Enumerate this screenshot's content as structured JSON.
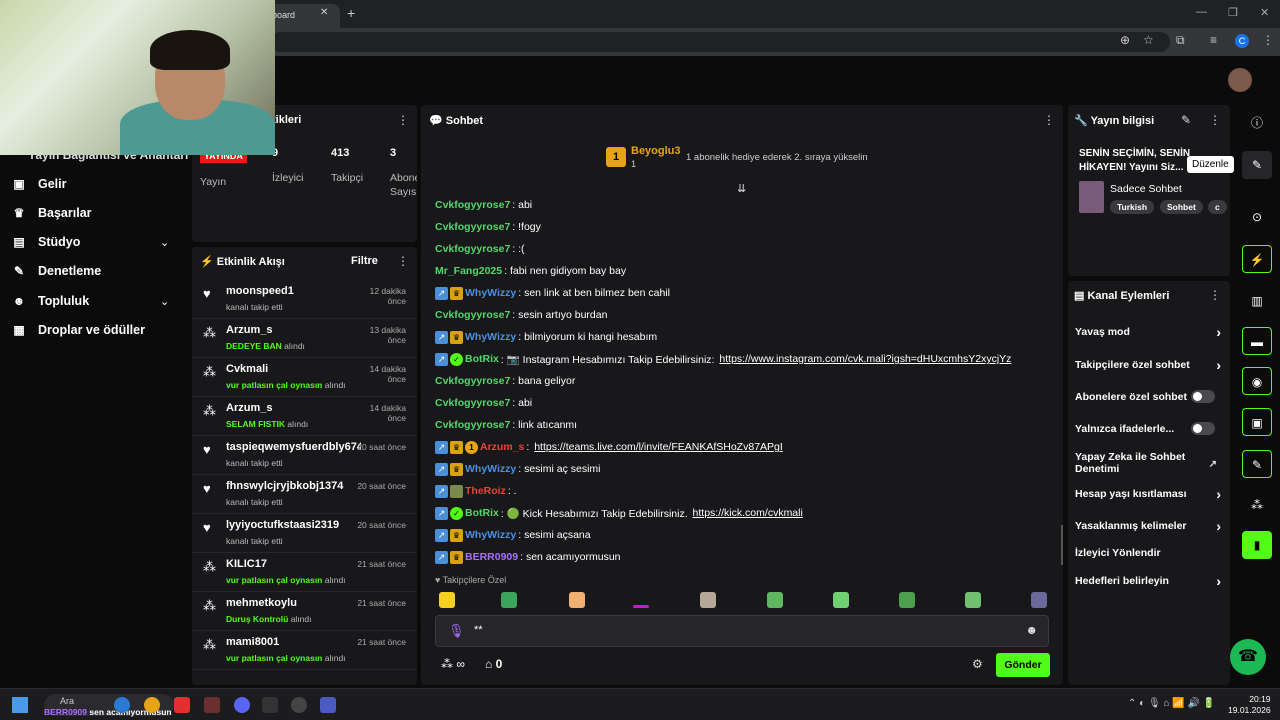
{
  "browser": {
    "tab_title": "board",
    "new_tab": "+",
    "window_controls": [
      "—",
      "❐",
      "✕"
    ],
    "profile_initial": "C"
  },
  "left_nav": {
    "partial_item": "Yayın Bağlantısı ve Anahtarı",
    "items": [
      {
        "label": "Gelir",
        "icon": "money-icon"
      },
      {
        "label": "Başarılar",
        "icon": "trophy-icon"
      },
      {
        "label": "Stüdyo",
        "icon": "studio-icon",
        "expandable": true
      },
      {
        "label": "Denetleme",
        "icon": "wrench-icon"
      },
      {
        "label": "Topluluk",
        "icon": "community-icon",
        "expandable": true
      },
      {
        "label": "Droplar ve ödüller",
        "icon": "drops-icon"
      }
    ]
  },
  "stats": {
    "title": "tikleri",
    "live_badge": "YAYINDA",
    "live_label": "Yayın",
    "viewers_value": "9",
    "viewers_label": "İzleyici",
    "followers_value": "413",
    "followers_label": "Takipçi",
    "subs_value": "3",
    "subs_label": "Abone Sayısı"
  },
  "feed": {
    "title": "Etkinlik Akışı",
    "filter": "Filtre",
    "items": [
      {
        "type": "follow",
        "name": "moonspeed1",
        "time": "12 dakika önce",
        "sub": "kanalı takip etti",
        "hl": ""
      },
      {
        "type": "reward",
        "name": "Arzum_s",
        "time": "13 dakika önce",
        "hl": "DEDEYE BAN",
        "sub": "alındı"
      },
      {
        "type": "reward",
        "name": "Cvkmali",
        "time": "14 dakika önce",
        "hl": "vur patlasın çal oynasın",
        "sub": "alındı"
      },
      {
        "type": "reward",
        "name": "Arzum_s",
        "time": "14 dakika önce",
        "hl": "SELAM FISTIK",
        "sub": "alındı"
      },
      {
        "type": "follow",
        "name": "taspieqwemysfuerdbly6743",
        "time": "20 saat önce",
        "sub": "kanalı takip etti",
        "hl": ""
      },
      {
        "type": "follow",
        "name": "fhnswylcjryjbkobj1374",
        "time": "20 saat önce",
        "sub": "kanalı takip etti",
        "hl": ""
      },
      {
        "type": "follow",
        "name": "lyyiyoctufkstaasi2319",
        "time": "20 saat önce",
        "sub": "kanalı takip etti",
        "hl": ""
      },
      {
        "type": "reward",
        "name": "KILIC17",
        "time": "21 saat önce",
        "hl": "vur patlasın çal oynasın",
        "sub": "alındı"
      },
      {
        "type": "reward",
        "name": "mehmetkoylu",
        "time": "21 saat önce",
        "hl": "Duruş Kontrolü",
        "sub": "alındı"
      },
      {
        "type": "reward",
        "name": "mami8001",
        "time": "21 saat önce",
        "hl": "vur patlasın çal oynasın",
        "sub": "alındı"
      }
    ]
  },
  "chat": {
    "title": "Sohbet",
    "pinned_name": "Beyoglu3",
    "pinned_rank": "1",
    "pinned_count": "1",
    "pinned_msg": "1 abonelik hediye ederek 2. sıraya yükselin",
    "messages": [
      {
        "badges": [],
        "user": "Cvkfogyyrose7",
        "color": "#53d769",
        "text": ": abi"
      },
      {
        "badges": [],
        "user": "Cvkfogyyrose7",
        "color": "#53d769",
        "text": ": !fogy"
      },
      {
        "badges": [],
        "user": "Cvkfogyyrose7",
        "color": "#53d769",
        "text": ": :("
      },
      {
        "badges": [],
        "user": "Mr_Fang2025",
        "color": "#53d769",
        "text": ": fabi nen gidiyom bay bay"
      },
      {
        "badges": [
          "mod",
          "crown"
        ],
        "user": "WhyWizzy",
        "color": "#4a90e2",
        "text": ": sen link at ben bilmez ben cahil"
      },
      {
        "badges": [],
        "user": "Cvkfogyyrose7",
        "color": "#53d769",
        "text": ": sesin artıyo burdan"
      },
      {
        "badges": [
          "mod",
          "crown"
        ],
        "user": "WhyWizzy",
        "color": "#4a90e2",
        "text": ": bilmiyorum ki hangi hesabım"
      },
      {
        "badges": [
          "mod",
          "bot"
        ],
        "user": "BotRix",
        "color": "#53d769",
        "text": ": 📷 Instagram Hesabımızı Takip Edebilirsiniz: ",
        "link": "https://www.instagram.com/cvk.mali?igsh=dHUxcmhsY2xycjYz"
      },
      {
        "badges": [],
        "user": "Cvkfogyyrose7",
        "color": "#53d769",
        "text": ": bana geliyor"
      },
      {
        "badges": [],
        "user": "Cvkfogyyrose7",
        "color": "#53d769",
        "text": ": abi"
      },
      {
        "badges": [],
        "user": "Cvkfogyyrose7",
        "color": "#53d769",
        "text": ": link atıcanmı"
      },
      {
        "badges": [
          "mod",
          "crown",
          "sub"
        ],
        "user": "Arzum_s",
        "color": "#e8443a",
        "text": ": ",
        "link": "https://teams.live.com/l/invite/FEANKAfSHoZv87APgI"
      },
      {
        "badges": [
          "mod",
          "crown"
        ],
        "user": "WhyWizzy",
        "color": "#4a90e2",
        "text": ": sesimi aç sesimi"
      },
      {
        "badges": [
          "mod",
          "img"
        ],
        "user": "TheRoiz",
        "color": "#e8443a",
        "text": ": ."
      },
      {
        "badges": [
          "mod",
          "bot"
        ],
        "user": "BotRix",
        "color": "#53d769",
        "text": ": 🟢 Kick Hesabımızı Takip Edebilirsiniz. ",
        "link": "https://kick.com/cvkmali"
      },
      {
        "badges": [
          "mod",
          "crown"
        ],
        "user": "WhyWizzy",
        "color": "#4a90e2",
        "text": ": sesimi açsana"
      },
      {
        "badges": [
          "mod",
          "crown"
        ],
        "user": "BERR0909",
        "color": "#a970ff",
        "text": ": sen acamıyormusun"
      }
    ],
    "followers_only": "♥ Takipçilere Özel",
    "input_value": "**",
    "points_value": "∞",
    "store_value": "0",
    "send_label": "Gönder"
  },
  "stream_info": {
    "title": "Yayın bilgisi",
    "stream_title": "SENİN SEÇİMİN, SENİN HİKAYEN! Yayını Siz...",
    "tooltip": "Düzenle",
    "category": "Sadece Sohbet",
    "tags": [
      "Turkish",
      "Sohbet",
      "c"
    ]
  },
  "channel_actions": {
    "title": "Kanal Eylemleri",
    "items": [
      {
        "label": "Yavaş mod",
        "control": "chevron"
      },
      {
        "label": "Takipçilere özel sohbet",
        "control": "chevron"
      },
      {
        "label": "Abonelere özel sohbet",
        "control": "toggle"
      },
      {
        "label": "Yalnızca ifadelerle...",
        "control": "toggle"
      },
      {
        "label": "Yapay Zeka ile Sohbet Denetimi",
        "control": "external"
      },
      {
        "label": "Hesap yaşı kısıtlaması",
        "control": "chevron"
      },
      {
        "label": "Yasaklanmış kelimeler",
        "control": "chevron"
      },
      {
        "label": "İzleyici Yönlendir",
        "control": "none"
      },
      {
        "label": "Hedefleri belirleyin",
        "control": "chevron"
      }
    ]
  },
  "taskbar": {
    "search": "Ara",
    "notification_user": "BERR0909",
    "notification_text": "sen acamıyormusun",
    "time": "20:19",
    "date": "19.01.2026"
  },
  "colors": {
    "accent_green": "#53fc18",
    "panel_bg": "#18181b",
    "live_red": "#e91916"
  }
}
